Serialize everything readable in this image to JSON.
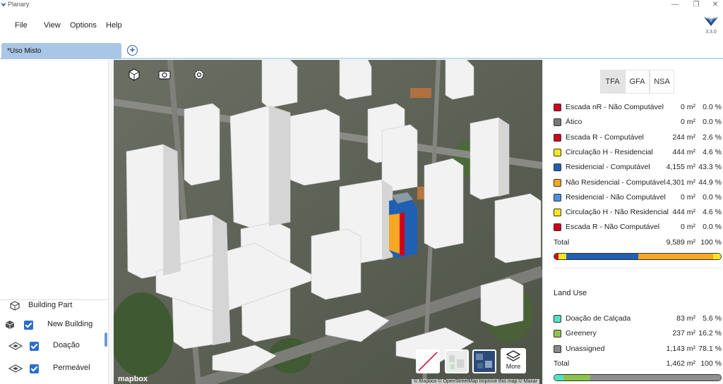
{
  "app": {
    "title": "Planary",
    "version": "3.3.0"
  },
  "window_controls": {
    "minimize": "—",
    "restore": "❐",
    "close": "✕"
  },
  "menu": {
    "items": [
      "File",
      "View",
      "Options",
      "Help"
    ]
  },
  "tabs": {
    "active_label": "*Uso Misto",
    "add_label": "+"
  },
  "tree": {
    "items": [
      {
        "label": "Building Part",
        "icon": "building-part-icon",
        "checked": false
      },
      {
        "label": "New Building",
        "icon": "cube-icon",
        "checked": true
      },
      {
        "label": "Doação",
        "icon": "layers-plane-icon",
        "checked": true
      },
      {
        "label": "Permeável",
        "icon": "layers-plane-icon",
        "checked": true
      }
    ]
  },
  "map": {
    "tools": [
      "cube-view-icon",
      "camera-icon",
      "settings-icon"
    ],
    "logo_text": "mapbox",
    "attribution": "© Mapbox © OpenStreetMap  Improve this map © Maxar",
    "more_label": "More",
    "layer_thumbs": [
      "no-layer-icon",
      "light-layer-icon",
      "satellite-layer-icon"
    ]
  },
  "area_panel": {
    "modes": [
      "TFA",
      "GFA",
      "NSA"
    ],
    "active_mode": "TFA",
    "rows": [
      {
        "label": "Escada nR - Não Computável",
        "area": "0 m²",
        "pct": "0.0 %",
        "color": "#d0021b"
      },
      {
        "label": "Ático",
        "area": "0 m²",
        "pct": "0.0 %",
        "color": "#777777"
      },
      {
        "label": "Escada R - Computável",
        "area": "244 m²",
        "pct": "2.6 %",
        "color": "#d0021b"
      },
      {
        "label": "Circulação H - Residencial",
        "area": "444 m²",
        "pct": "4.6 %",
        "color": "#f8e71c"
      },
      {
        "label": "Residencial - Computável",
        "area": "4,155 m²",
        "pct": "43.3 %",
        "color": "#1f5fb4"
      },
      {
        "label": "Não Residencial - Computável",
        "area": "4,301 m²",
        "pct": "44.9 %",
        "color": "#f5a623"
      },
      {
        "label": "Residencial - Não Computável",
        "area": "0 m²",
        "pct": "0.0 %",
        "color": "#4a90e2"
      },
      {
        "label": "Circulação H - Não Residencial",
        "area": "444 m²",
        "pct": "4.6 %",
        "color": "#f8e71c"
      },
      {
        "label": "Escada R - Não Computável",
        "area": "0 m²",
        "pct": "0.0 %",
        "color": "#d0021b"
      }
    ],
    "total": {
      "label": "Total",
      "area": "9,589 m²",
      "pct": "100 %"
    },
    "bar_segments": [
      {
        "color": "#d0021b",
        "fraction": 0.026
      },
      {
        "color": "#f8e71c",
        "fraction": 0.046
      },
      {
        "color": "#1f5fb4",
        "fraction": 0.433
      },
      {
        "color": "#f5a623",
        "fraction": 0.449
      },
      {
        "color": "#f8e71c",
        "fraction": 0.046
      }
    ]
  },
  "land_use": {
    "title": "Land Use",
    "rows": [
      {
        "label": "Doação de Calçada",
        "area": "83 m²",
        "pct": "5.6 %",
        "color": "#50e3c2"
      },
      {
        "label": "Greenery",
        "area": "237 m²",
        "pct": "16.2 %",
        "color": "#8bc34a"
      },
      {
        "label": "Unassigned",
        "area": "1,143 m²",
        "pct": "78.1 %",
        "color": "#888888"
      }
    ],
    "total": {
      "label": "Total",
      "area": "1,462 m²",
      "pct": "100 %"
    },
    "bar_segments": [
      {
        "color": "#50e3c2",
        "fraction": 0.056
      },
      {
        "color": "#8bc34a",
        "fraction": 0.162
      },
      {
        "color": "#8f8f8f",
        "fraction": 0.781
      }
    ]
  }
}
